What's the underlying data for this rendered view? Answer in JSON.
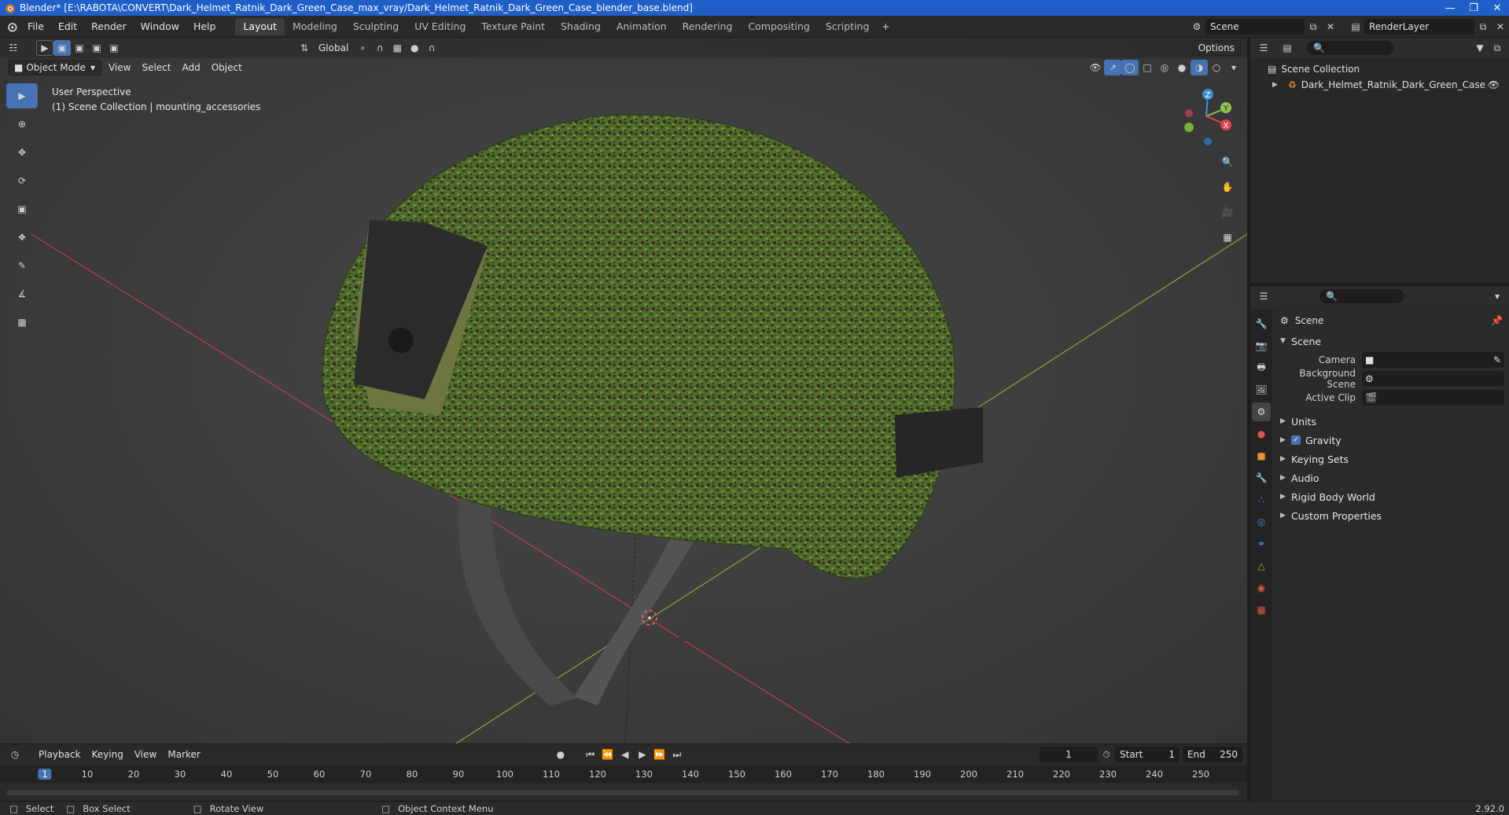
{
  "window": {
    "title": "Blender* [E:\\RABOTA\\CONVERT\\Dark_Helmet_Ratnik_Dark_Green_Case_max_vray/Dark_Helmet_Ratnik_Dark_Green_Case_blender_base.blend]"
  },
  "menu": [
    "File",
    "Edit",
    "Render",
    "Window",
    "Help"
  ],
  "workspaces": [
    "Layout",
    "Modeling",
    "Sculpting",
    "UV Editing",
    "Texture Paint",
    "Shading",
    "Animation",
    "Rendering",
    "Compositing",
    "Scripting"
  ],
  "top_right": {
    "scene": "Scene",
    "render_layer": "RenderLayer"
  },
  "viewport": {
    "mode": "Object Mode",
    "menus": [
      "View",
      "Select",
      "Add",
      "Object"
    ],
    "transform_orientation": "Global",
    "options_label": "Options",
    "info_line1": "User Perspective",
    "info_line2": "(1) Scene Collection | mounting_accessories",
    "gizmo": {
      "z": "Z",
      "y": "Y",
      "x": "X"
    }
  },
  "timeline": {
    "menus": [
      "Playback",
      "Keying",
      "View",
      "Marker"
    ],
    "current_frame": "1",
    "start_label": "Start",
    "start": "1",
    "end_label": "End",
    "end": "250",
    "ticks": [
      "1",
      "10",
      "20",
      "30",
      "40",
      "50",
      "60",
      "70",
      "80",
      "90",
      "100",
      "110",
      "120",
      "130",
      "140",
      "150",
      "160",
      "170",
      "180",
      "190",
      "200",
      "210",
      "220",
      "230",
      "240",
      "250"
    ]
  },
  "statusbar": {
    "select": "Select",
    "box_select": "Box Select",
    "rotate_view": "Rotate View",
    "context_menu": "Object Context Menu",
    "version": "2.92.0"
  },
  "outliner": {
    "root": "Scene Collection",
    "items": [
      "Dark_Helmet_Ratnik_Dark_Green_Case"
    ]
  },
  "properties": {
    "header": "Scene",
    "section": "Scene",
    "camera_label": "Camera",
    "background_scene_label": "Background Scene",
    "active_clip_label": "Active Clip",
    "panels": [
      "Units",
      "Gravity",
      "Keying Sets",
      "Audio",
      "Rigid Body World",
      "Custom Properties"
    ],
    "gravity_checked": true
  },
  "colors": {
    "accent": "#4772b3",
    "titlebar": "#1f5fc7",
    "x_axis": "#e0404f",
    "y_axis": "#8bc34a",
    "z_axis": "#3f8ddb"
  }
}
